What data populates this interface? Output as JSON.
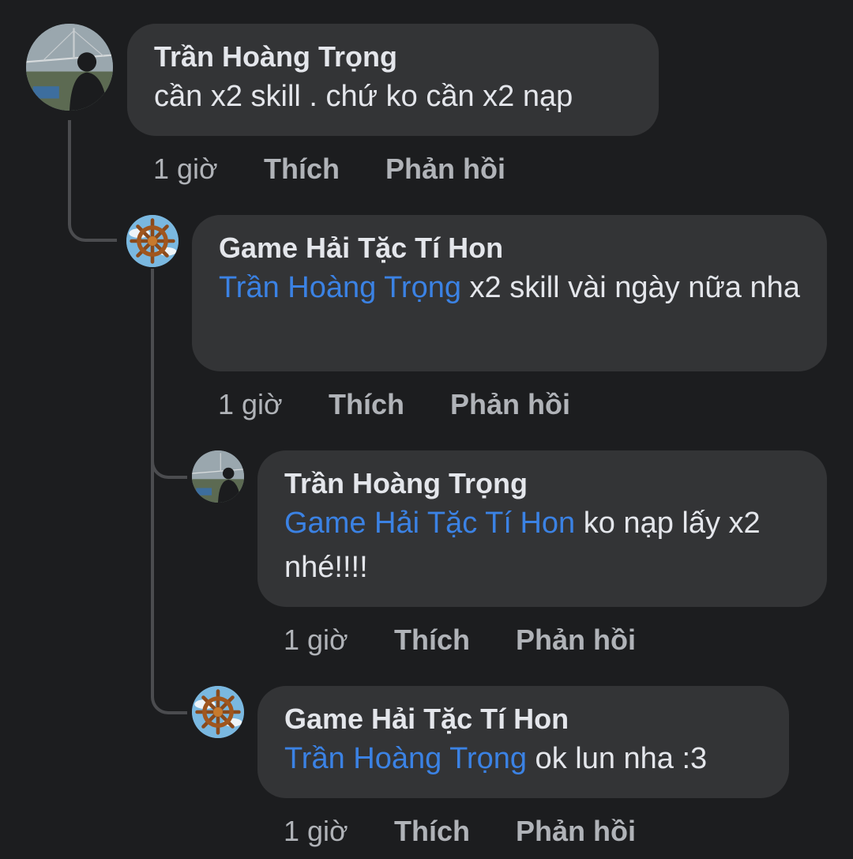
{
  "comments": [
    {
      "author": "Trần Hoàng Trọng",
      "text": "cần x2 skill . chứ ko cần x2 nạp",
      "mention": "",
      "time": "1 giờ",
      "like_label": "Thích",
      "reply_label": "Phản hồi",
      "avatar_icon": "person-bridge-photo-avatar"
    },
    {
      "author": "Game Hải Tặc Tí Hon",
      "mention": "Trần Hoàng Trọng",
      "text": " x2 skill vài ngày nữa nha",
      "time": "1 giờ",
      "like_label": "Thích",
      "reply_label": "Phản hồi",
      "avatar_icon": "ship-wheel-avatar"
    },
    {
      "author": "Trần Hoàng Trọng",
      "mention": "Game Hải Tặc Tí Hon",
      "text": " ko nạp lấy x2 nhé!!!!",
      "time": "1 giờ",
      "like_label": "Thích",
      "reply_label": "Phản hồi",
      "avatar_icon": "person-bridge-photo-avatar"
    },
    {
      "author": "Game Hải Tặc Tí Hon",
      "mention": "Trần Hoàng Trọng",
      "text": " ok lun nha :3",
      "time": "1 giờ",
      "like_label": "Thích",
      "reply_label": "Phản hồi",
      "avatar_icon": "ship-wheel-avatar"
    }
  ],
  "colors": {
    "background": "#1c1d1f",
    "bubble": "#333436",
    "mention": "#3b82e4",
    "meta_text": "#b0b3b8",
    "thread_line": "#4b4c4f"
  }
}
